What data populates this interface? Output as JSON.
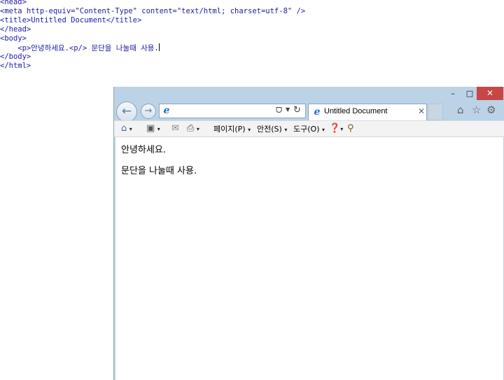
{
  "code": {
    "lines": [
      "<head>",
      "<meta http-equiv=\"Content-Type\" content=\"text/html; charset=utf-8\" />",
      "<title>Untitled Document</title>",
      "</head>",
      "<body>",
      "    <p>안녕하세요.<p/> 문단을 나눌때 사용.",
      "</body>",
      "</html>"
    ]
  },
  "browser": {
    "window_controls": {
      "minimize": "–",
      "maximize": "□",
      "close": "✕"
    },
    "nav": {
      "back_icon": "back-arrow-icon",
      "forward_icon": "forward-arrow-icon"
    },
    "address": {
      "value": "",
      "search_glyph": "ᗜ",
      "dropdown_glyph": "▼",
      "refresh_glyph": "↻"
    },
    "tab": {
      "title": "Untitled Document",
      "close_glyph": "✕"
    },
    "right_icons": {
      "home": "⌂",
      "favorites": "☆",
      "tools": "⚙"
    },
    "command_bar": {
      "page_label": "페이지(P)",
      "safety_label": "안전(S)",
      "tools_label": "도구(O)",
      "arrow_glyph": "▾"
    },
    "content": {
      "paragraph1": "안녕하세요.",
      "paragraph2": "문단을 나눌때 사용."
    }
  },
  "colors": {
    "frame": "#bcd2e6",
    "close_button": "#c74646",
    "code_tag": "#1a1aa6"
  }
}
